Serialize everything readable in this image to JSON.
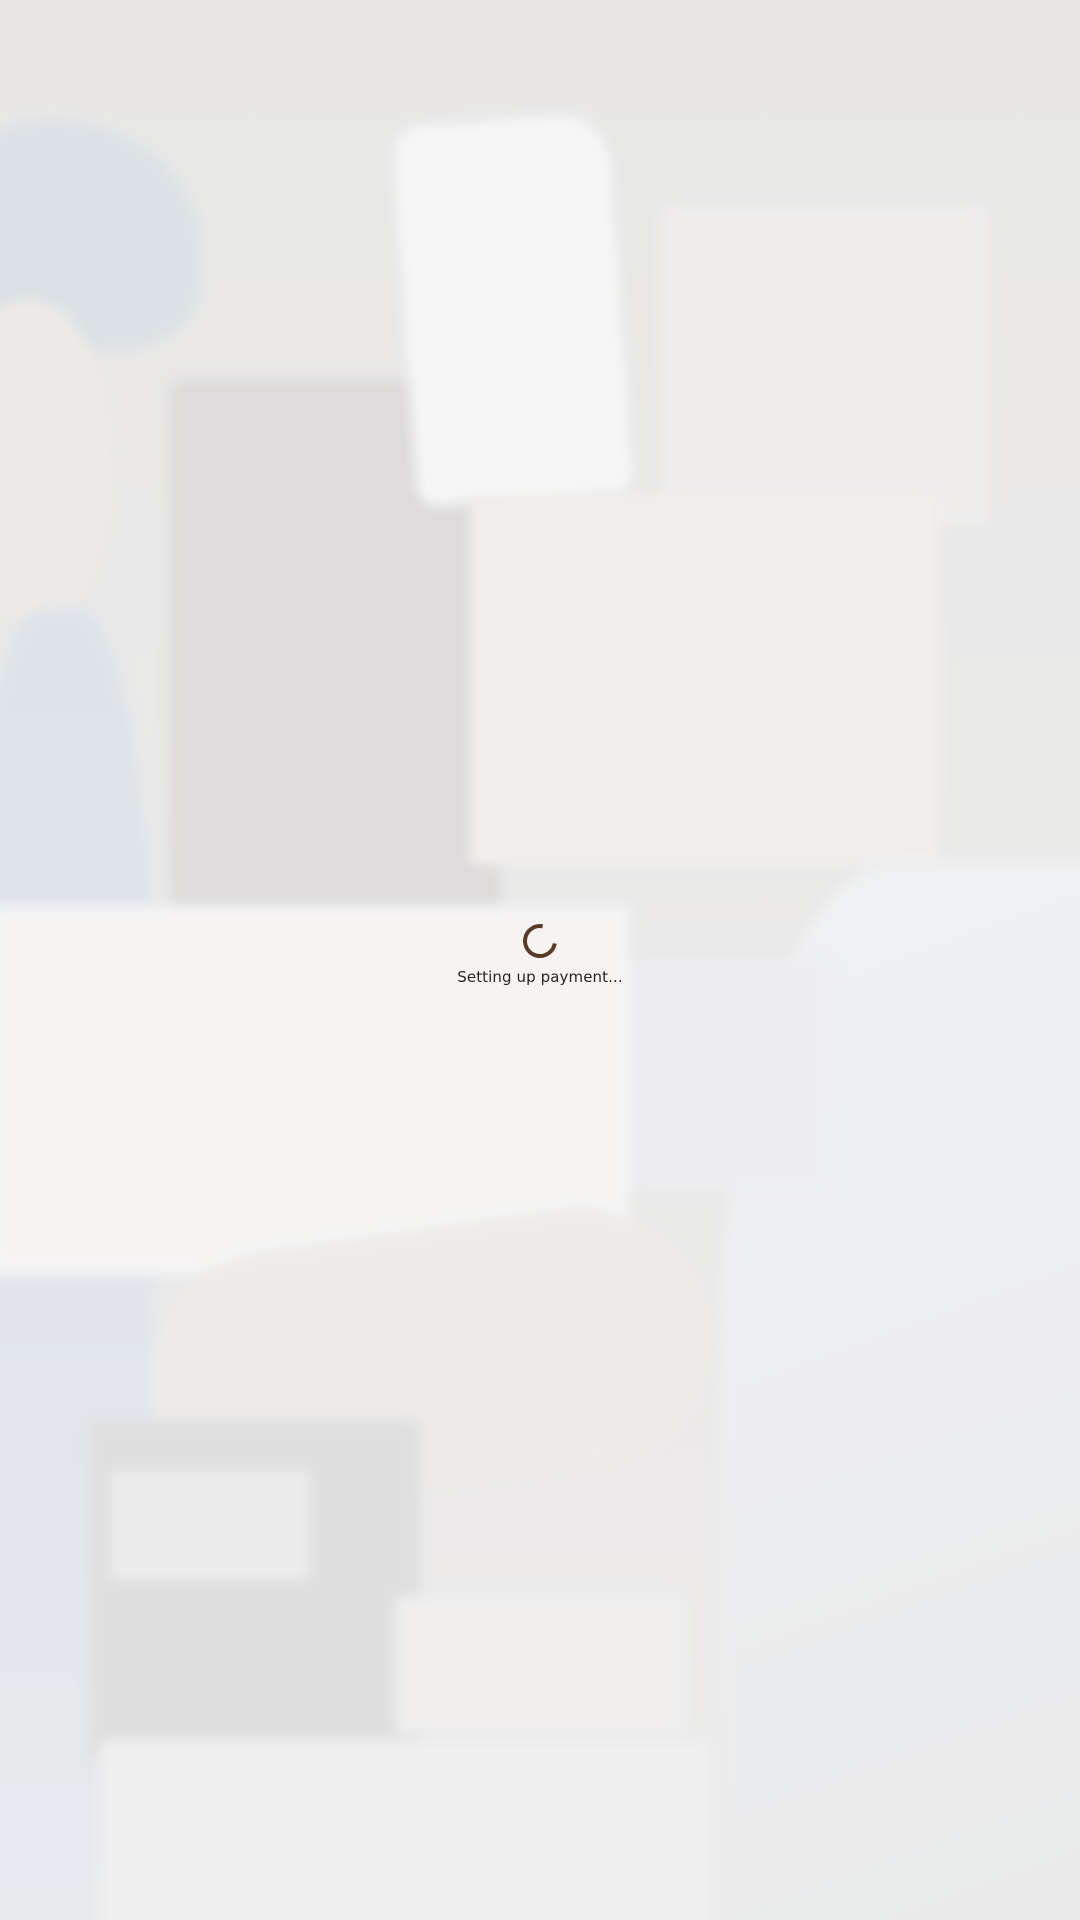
{
  "loading": {
    "message": "Setting up payment...",
    "spinner_icon": "spinner-icon",
    "spinner_color": "#5a3a24"
  },
  "background": {
    "description_icon": "background-photo"
  }
}
